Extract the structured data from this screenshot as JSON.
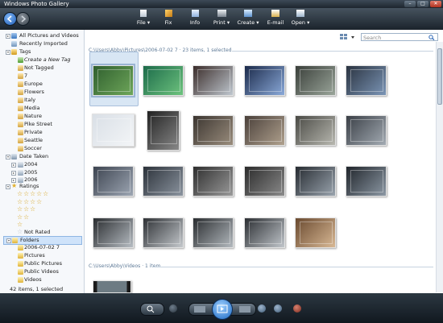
{
  "window": {
    "title": "Windows Photo Gallery"
  },
  "toolbar": {
    "file": "File ▾",
    "fix": "Fix",
    "info": "Info",
    "print": "Print ▾",
    "create": "Create ▾",
    "email": "E-mail",
    "open": "Open ▾"
  },
  "sidebar": {
    "all": "All Pictures and Videos",
    "recent": "Recently Imported",
    "tags": "Tags",
    "create_tag": "Create a New Tag",
    "not_tagged": "Not Tagged",
    "tag_items": [
      "7",
      "Europe",
      "Flowers",
      "Italy",
      "Media",
      "Nature",
      "Pike Street",
      "Private",
      "Seattle",
      "Soccer"
    ],
    "date_taken": "Date Taken",
    "years": [
      "2004",
      "2005",
      "2006"
    ],
    "ratings": "Ratings",
    "not_rated": "Not Rated",
    "folders": "Folders",
    "folder_items": [
      "2006-07-02 7",
      "Pictures",
      "Public Pictures",
      "Public Videos",
      "Videos"
    ],
    "status": "42 items, 1 selected"
  },
  "search": {
    "placeholder": "Search"
  },
  "groups": {
    "pictures_header": "C:\\Users\\Abby\\Pictures\\2006-07-02 7 · 23 items, 1 selected",
    "videos_header": "C:\\Users\\Abby\\Videos · 1 item"
  },
  "colors": {
    "accent": "#1a68c2",
    "selection": "#d8e6f4",
    "toolbar": "#1b232b"
  },
  "icons": [
    "back-icon",
    "forward-icon",
    "file-icon",
    "fix-icon",
    "info-icon",
    "print-icon",
    "create-icon",
    "email-icon",
    "open-icon",
    "search-icon",
    "view-icon",
    "folder-icon",
    "tag-icon",
    "star-icon",
    "play-icon",
    "zoom-icon",
    "rotate-icon",
    "delete-icon"
  ]
}
